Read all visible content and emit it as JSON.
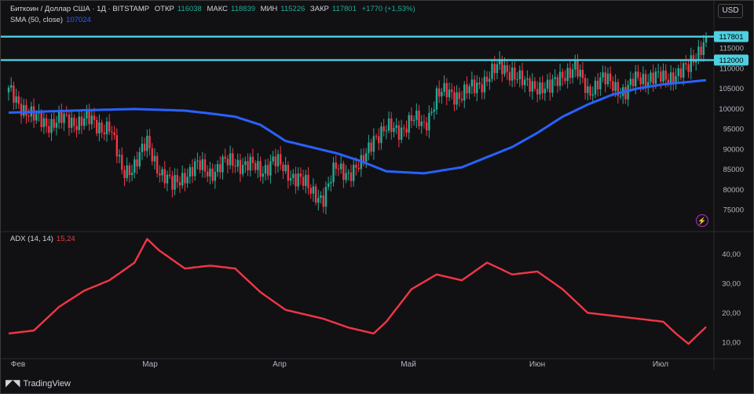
{
  "header": {
    "symbol": "Биткоин / Доллар США · 1Д · BITSTAMP",
    "open_label": "ОТКР",
    "open_value": "116038",
    "high_label": "МАКС",
    "high_value": "118839",
    "low_label": "МИН",
    "low_value": "115226",
    "close_label": "ЗАКР",
    "close_value": "117801",
    "change": "+1770 (+1,53%)",
    "sma_label": "SMA (50, close)",
    "sma_value": "107024",
    "adx_label": "ADX (14, 14)",
    "adx_value": "15,24"
  },
  "currency_button": "USD",
  "logo_text": "TradingView",
  "colors": {
    "up": "#22ab94",
    "down": "#f23645",
    "sma": "#2962ff",
    "level": "#4dd0e1",
    "adx": "#f23645"
  },
  "chart_data": [
    {
      "type": "candlestick",
      "title": "Биткоин / Доллар США · 1Д · BITSTAMP",
      "ylim": [
        70000,
        122000
      ],
      "y_ticks": [
        "75000",
        "80000",
        "85000",
        "90000",
        "95000",
        "100000",
        "105000",
        "110000",
        "115000"
      ],
      "x_ticks": [
        "Фев",
        "Мар",
        "Апр",
        "Май",
        "Июн",
        "Июл"
      ],
      "price_labels": [
        "117801",
        "112000"
      ],
      "horizontal_levels": [
        117801,
        112000
      ],
      "sma_label": "SMA (50, close)",
      "sma": [
        [
          0,
          99000
        ],
        [
          30,
          99600
        ],
        [
          50,
          99900
        ],
        [
          70,
          99500
        ],
        [
          80,
          98800
        ],
        [
          90,
          98000
        ],
        [
          100,
          96000
        ],
        [
          110,
          92000
        ],
        [
          120,
          90500
        ],
        [
          130,
          89000
        ],
        [
          140,
          87000
        ],
        [
          150,
          84500
        ],
        [
          165,
          84000
        ],
        [
          180,
          85500
        ],
        [
          190,
          88000
        ],
        [
          200,
          90500
        ],
        [
          210,
          94000
        ],
        [
          220,
          98000
        ],
        [
          230,
          101000
        ],
        [
          240,
          103500
        ],
        [
          250,
          105000
        ],
        [
          260,
          106000
        ],
        [
          270,
          106600
        ],
        [
          277,
          107024
        ]
      ],
      "closes": [
        [
          0,
          104000
        ],
        [
          5,
          101000
        ],
        [
          10,
          97500
        ],
        [
          15,
          96500
        ],
        [
          20,
          97000
        ],
        [
          25,
          96800
        ],
        [
          30,
          97500
        ],
        [
          35,
          95500
        ],
        [
          40,
          96000
        ],
        [
          45,
          84000
        ],
        [
          50,
          86500
        ],
        [
          55,
          91000
        ],
        [
          60,
          85000
        ],
        [
          65,
          80500
        ],
        [
          70,
          84000
        ],
        [
          75,
          85500
        ],
        [
          80,
          84500
        ],
        [
          85,
          86000
        ],
        [
          90,
          87000
        ],
        [
          95,
          86000
        ],
        [
          100,
          84500
        ],
        [
          105,
          87500
        ],
        [
          110,
          84000
        ],
        [
          115,
          83500
        ],
        [
          120,
          79000
        ],
        [
          125,
          78500
        ],
        [
          130,
          85000
        ],
        [
          135,
          84500
        ],
        [
          140,
          85500
        ],
        [
          145,
          93500
        ],
        [
          150,
          94500
        ],
        [
          155,
          95000
        ],
        [
          160,
          97000
        ],
        [
          165,
          96000
        ],
        [
          170,
          103000
        ],
        [
          175,
          104000
        ],
        [
          180,
          103500
        ],
        [
          185,
          105000
        ],
        [
          190,
          108000
        ],
        [
          195,
          110000
        ],
        [
          200,
          109500
        ],
        [
          205,
          105500
        ],
        [
          210,
          106000
        ],
        [
          215,
          104500
        ],
        [
          220,
          109000
        ],
        [
          225,
          109500
        ],
        [
          230,
          104500
        ],
        [
          235,
          107000
        ],
        [
          240,
          106000
        ],
        [
          245,
          104000
        ],
        [
          250,
          107500
        ],
        [
          255,
          108000
        ],
        [
          260,
          107000
        ],
        [
          265,
          109000
        ],
        [
          270,
          109500
        ],
        [
          275,
          116000
        ],
        [
          277,
          117801
        ]
      ]
    },
    {
      "type": "line",
      "title": "ADX (14, 14)",
      "ylim": [
        5,
        47
      ],
      "y_ticks": [
        "10,00",
        "20,00",
        "30,00",
        "40,00"
      ],
      "series": [
        {
          "name": "ADX (14, 14)",
          "points": [
            [
              0,
              13
            ],
            [
              10,
              14
            ],
            [
              20,
              22
            ],
            [
              30,
              27.5
            ],
            [
              40,
              31
            ],
            [
              50,
              37
            ],
            [
              55,
              45
            ],
            [
              60,
              41
            ],
            [
              70,
              35
            ],
            [
              80,
              36
            ],
            [
              90,
              35
            ],
            [
              100,
              27
            ],
            [
              110,
              21
            ],
            [
              120,
              19
            ],
            [
              125,
              18
            ],
            [
              135,
              15
            ],
            [
              145,
              13
            ],
            [
              150,
              17
            ],
            [
              160,
              28
            ],
            [
              170,
              33
            ],
            [
              175,
              32
            ],
            [
              180,
              31
            ],
            [
              190,
              37
            ],
            [
              200,
              33
            ],
            [
              210,
              34
            ],
            [
              220,
              28
            ],
            [
              230,
              20
            ],
            [
              240,
              19
            ],
            [
              250,
              18
            ],
            [
              260,
              17
            ],
            [
              265,
              13
            ],
            [
              270,
              9.5
            ],
            [
              277,
              15.24
            ]
          ]
        }
      ]
    }
  ]
}
